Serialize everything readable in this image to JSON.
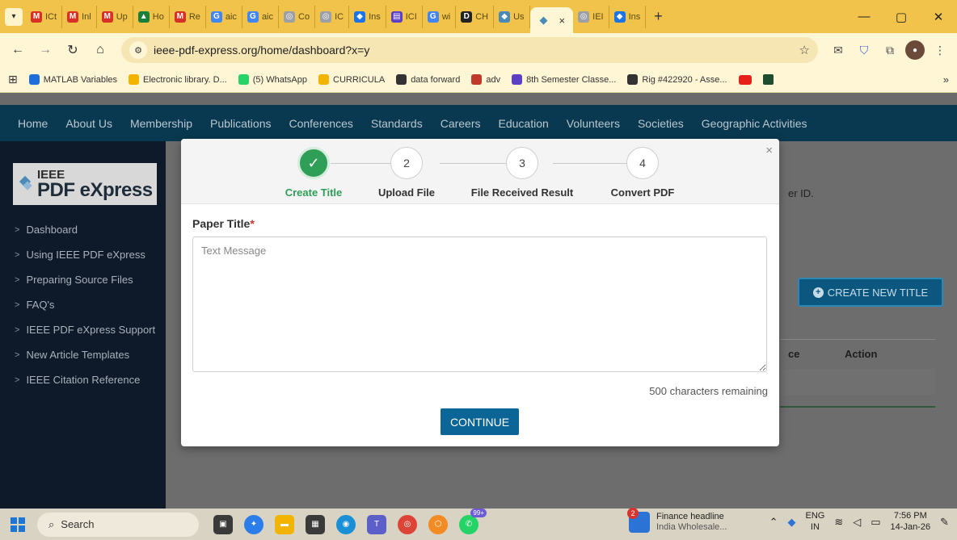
{
  "browser": {
    "tabs": [
      {
        "label": "ICt",
        "fav": "M",
        "color": "#d93025"
      },
      {
        "label": "Inl",
        "fav": "M",
        "color": "#d93025"
      },
      {
        "label": "Up",
        "fav": "M",
        "color": "#d93025"
      },
      {
        "label": "Ho",
        "fav": "▲",
        "color": "#188038"
      },
      {
        "label": "Re",
        "fav": "M",
        "color": "#d93025"
      },
      {
        "label": "aic",
        "fav": "G",
        "color": "#4285f4"
      },
      {
        "label": "aic",
        "fav": "G",
        "color": "#4285f4"
      },
      {
        "label": "Co",
        "fav": "◎",
        "color": "#9aa0a6"
      },
      {
        "label": "IC",
        "fav": "◎",
        "color": "#9aa0a6"
      },
      {
        "label": "Ins",
        "fav": "◆",
        "color": "#1a73e8"
      },
      {
        "label": "ICI",
        "fav": "▤",
        "color": "#5b3fc4"
      },
      {
        "label": "wi",
        "fav": "G",
        "color": "#4285f4"
      },
      {
        "label": "CH",
        "fav": "D",
        "color": "#222222"
      },
      {
        "label": "Us",
        "fav": "◆",
        "color": "#4a8ab8"
      }
    ],
    "active_tab": {
      "fav": "◆",
      "close": "×"
    },
    "tabs_after": [
      {
        "label": "IEI",
        "fav": "◎",
        "color": "#9aa0a6"
      },
      {
        "label": "Ins",
        "fav": "◆",
        "color": "#1a73e8"
      }
    ],
    "new_tab": "+",
    "window": {
      "minimize": "—",
      "restore": "▢",
      "close": "✕"
    },
    "url": "ieee-pdf-express.org/home/dashboard?x=y",
    "bookmarks": [
      {
        "label": "MATLAB Variables",
        "color": "#1e6fd9"
      },
      {
        "label": "Electronic library. D...",
        "color": "#f2b400"
      },
      {
        "label": "(5) WhatsApp",
        "color": "#25d366"
      },
      {
        "label": "CURRICULA",
        "color": "#f2b400"
      },
      {
        "label": "data forward",
        "color": "#333333"
      },
      {
        "label": "adv",
        "color": "#c0392b"
      },
      {
        "label": "8th Semester Classe...",
        "color": "#5b3fc4"
      },
      {
        "label": "Rig #422920 - Asse...",
        "color": "#333333"
      }
    ],
    "bookmarks_more": "»"
  },
  "site": {
    "nav": [
      "Home",
      "About Us",
      "Membership",
      "Publications",
      "Conferences",
      "Standards",
      "Careers",
      "Education",
      "Volunteers",
      "Societies",
      "Geographic Activities"
    ],
    "logo_top": "IEEE",
    "logo_bottom": "PDF eXpress",
    "sidebar": [
      "Dashboard",
      "Using IEEE PDF eXpress",
      "Preparing Source Files",
      "FAQ's",
      "IEEE PDF eXpress Support",
      "New Article Templates",
      "IEEE Citation Reference"
    ],
    "bg_text": "er ID.",
    "create_button": "CREATE NEW TITLE",
    "table_headers": [
      "ce",
      "Action"
    ]
  },
  "modal": {
    "steps": [
      {
        "number": "✓",
        "label": "Create Title"
      },
      {
        "number": "2",
        "label": "Upload File"
      },
      {
        "number": "3",
        "label": "File Received Result"
      },
      {
        "number": "4",
        "label": "Convert PDF"
      }
    ],
    "field_label": "Paper Title",
    "required_mark": "*",
    "placeholder": "Text Message",
    "chars_remaining": "500 characters remaining",
    "continue": "CONTINUE",
    "close": "×"
  },
  "taskbar": {
    "search": "Search",
    "whatsapp_badge": "99+",
    "news_badge": "2",
    "news_title": "Finance headline",
    "news_subtitle": "India Wholesale...",
    "lang_top": "ENG",
    "lang_bottom": "IN",
    "time": "7:56 PM",
    "date": "14-Jan-26"
  }
}
